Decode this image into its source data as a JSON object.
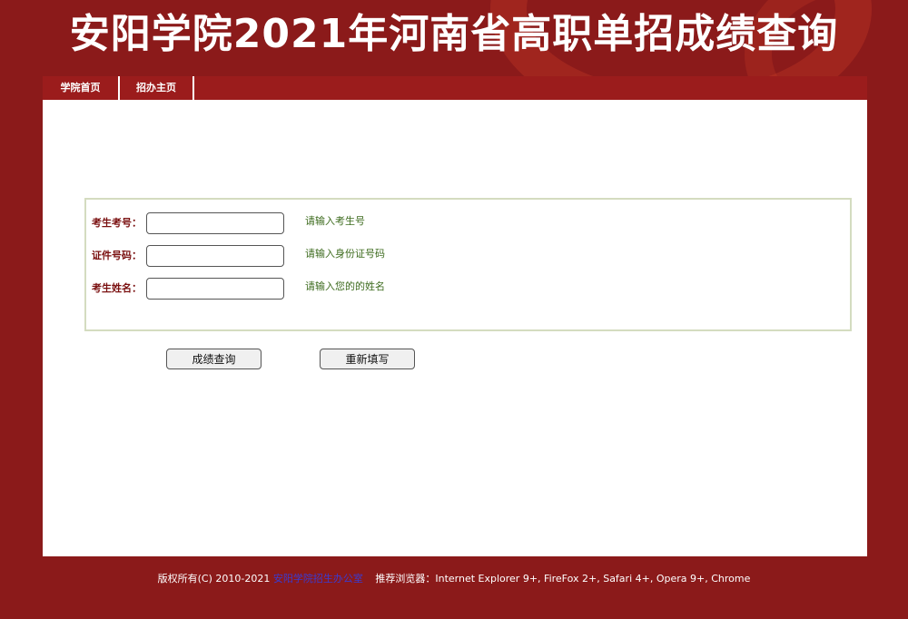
{
  "header": {
    "title": "安阳学院2021年河南省高职单招成绩查询"
  },
  "nav": {
    "items": [
      {
        "label": "学院首页"
      },
      {
        "label": "招办主页"
      }
    ]
  },
  "form": {
    "fields": [
      {
        "label": "考生考号：",
        "value": "",
        "hint": "请输入考生号"
      },
      {
        "label": "证件号码：",
        "value": "",
        "hint": "请输入身份证号码"
      },
      {
        "label": "考生姓名：",
        "value": "",
        "hint": "请输入您的的姓名"
      }
    ],
    "submit_label": "成绩查询",
    "reset_label": "重新填写"
  },
  "footer": {
    "copyright": "版权所有(C) 2010-2021",
    "office_link": "安阳学院招生办公室",
    "browsers": "推荐浏览器：Internet Explorer 9+, FireFox 2+, Safari 4+, Opera 9+, Chrome"
  },
  "colors": {
    "background": "#8b1a1a",
    "label": "#7a1010",
    "hint": "#3d6b1e",
    "link": "#3b3bd0"
  }
}
